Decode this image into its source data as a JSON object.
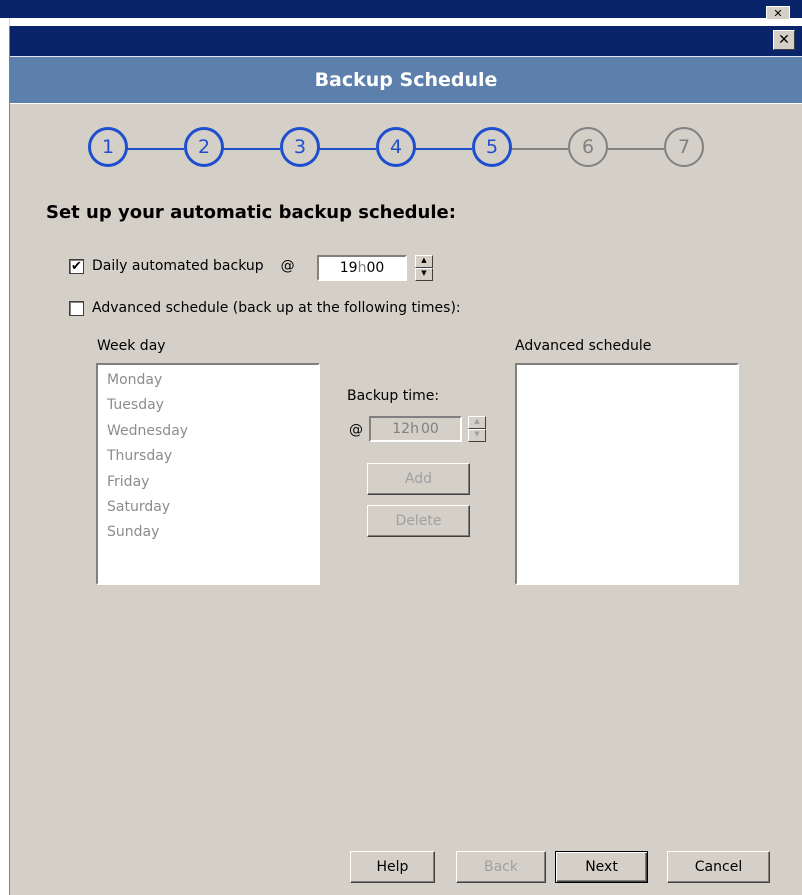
{
  "window": {
    "title": "Backup Schedule",
    "close_glyph": "✕"
  },
  "stepper": {
    "current_step": 5,
    "steps": [
      {
        "label": "1",
        "state": "done"
      },
      {
        "label": "2",
        "state": "done"
      },
      {
        "label": "3",
        "state": "done"
      },
      {
        "label": "4",
        "state": "done"
      },
      {
        "label": "5",
        "state": "done"
      },
      {
        "label": "6",
        "state": "todo"
      },
      {
        "label": "7",
        "state": "todo"
      }
    ]
  },
  "colors": {
    "accent": "#1f4fcf",
    "inactive": "#808080",
    "header": "#5d7fac",
    "titlebar": "#0a246a",
    "dialog_bg": "#d4d0c8"
  },
  "heading": "Set up your automatic backup schedule:",
  "daily": {
    "checked": true,
    "check_glyph": "✔",
    "label": "Daily automated backup",
    "at": "@",
    "hours": "19",
    "sep": "h",
    "minutes": "00"
  },
  "advanced": {
    "checked": false,
    "label": "Advanced schedule (back up at the following times):"
  },
  "week_day": {
    "label": "Week day",
    "items": [
      "Monday",
      "Tuesday",
      "Wednesday",
      "Thursday",
      "Friday",
      "Saturday",
      "Sunday"
    ]
  },
  "backup_time": {
    "label": "Backup time:",
    "at": "@",
    "hours": "12",
    "sep": "h",
    "minutes": "00"
  },
  "actions": {
    "add": "Add",
    "delete": "Delete"
  },
  "advanced_schedule": {
    "label": "Advanced schedule",
    "items": []
  },
  "footer": {
    "help": "Help",
    "back": "Back",
    "next": "Next",
    "cancel": "Cancel"
  },
  "icons": {
    "close": "close-icon",
    "spin_up": "spin-up-icon",
    "spin_down": "spin-down-icon",
    "checkmark": "checkmark-icon"
  }
}
